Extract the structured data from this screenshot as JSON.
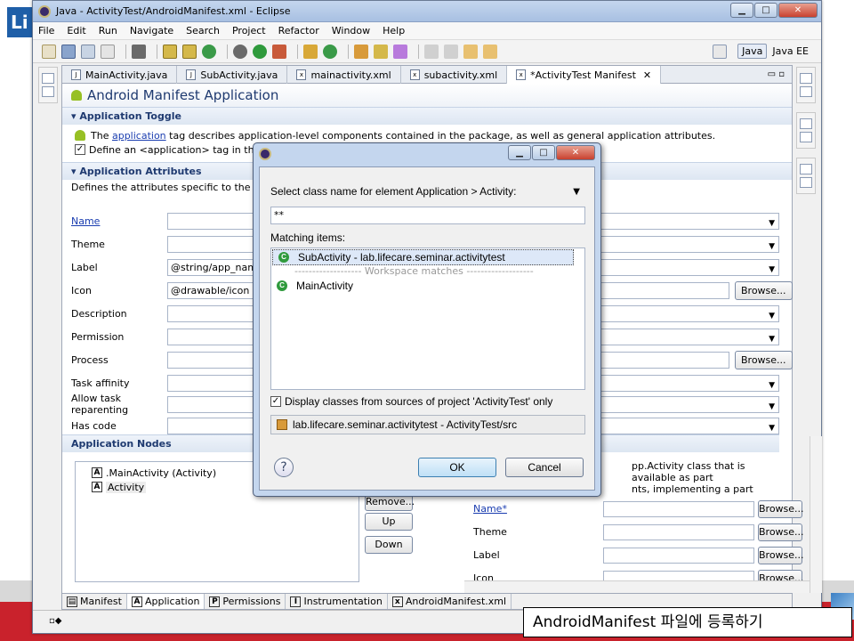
{
  "window": {
    "title": "Java - ActivityTest/AndroidManifest.xml - Eclipse"
  },
  "slide": {
    "corner_text": "Li"
  },
  "menu": [
    "File",
    "Edit",
    "Run",
    "Navigate",
    "Search",
    "Project",
    "Refactor",
    "Window",
    "Help"
  ],
  "perspectives": {
    "java": "Java",
    "javaee": "Java EE"
  },
  "editor_tabs": [
    "MainActivity.java",
    "SubActivity.java",
    "mainactivity.xml",
    "subactivity.xml",
    "*ActivityTest Manifest"
  ],
  "page_title": "Android Manifest Application",
  "toggle": {
    "header": "Application Toggle",
    "line1_prefix": "The",
    "line1_link": "application",
    "line1_suffix": "tag describes application-level components contained in the package, as well as general application attributes.",
    "line2": "Define an <application> tag in the Andr"
  },
  "attributes": {
    "header": "Application Attributes",
    "desc": "Defines the attributes specific to the applica",
    "fields": [
      {
        "label": "Name",
        "value": "",
        "link": true
      },
      {
        "label": "Theme",
        "value": ""
      },
      {
        "label": "Label",
        "value": "@string/app_name"
      },
      {
        "label": "Icon",
        "value": "@drawable/icon"
      },
      {
        "label": "Description",
        "value": ""
      },
      {
        "label": "Permission",
        "value": ""
      },
      {
        "label": "Process",
        "value": ""
      },
      {
        "label": "Task affinity",
        "value": ""
      },
      {
        "label": "Allow task reparenting",
        "value": ""
      },
      {
        "label": "Has code",
        "value": ""
      }
    ],
    "browse": "Browse..."
  },
  "nodes": {
    "header": "Application Nodes",
    "items": [
      ".MainActivity (Activity)",
      "Activity"
    ],
    "buttons": {
      "remove": "Remove...",
      "up": "Up",
      "down": "Down"
    },
    "detail_text1": "pp.Activity class that is available as part",
    "detail_text2": "nts, implementing a part",
    "detail_fields": [
      "Name*",
      "Theme",
      "Label",
      "Icon"
    ]
  },
  "bottom_tabs": [
    "Manifest",
    "Application",
    "Permissions",
    "Instrumentation",
    "AndroidManifest.xml"
  ],
  "dialog": {
    "prompt": "Select class name for element Application > Activity:",
    "filter": "**",
    "matching_label": "Matching items:",
    "items": [
      {
        "name": "SubActivity - lab.lifecare.seminar.activitytest",
        "selected": true
      },
      {
        "name": "MainActivity",
        "selected": false
      }
    ],
    "workspace_sep": "------------------- Workspace matches -------------------",
    "checkbox_label": "Display classes from sources of project 'ActivityTest' only",
    "checkbox_checked": true,
    "package": "lab.lifecare.seminar.activitytest - ActivityTest/src",
    "ok": "OK",
    "cancel": "Cancel",
    "help": "?"
  },
  "caption": "AndroidManifest 파일에 등록하기"
}
